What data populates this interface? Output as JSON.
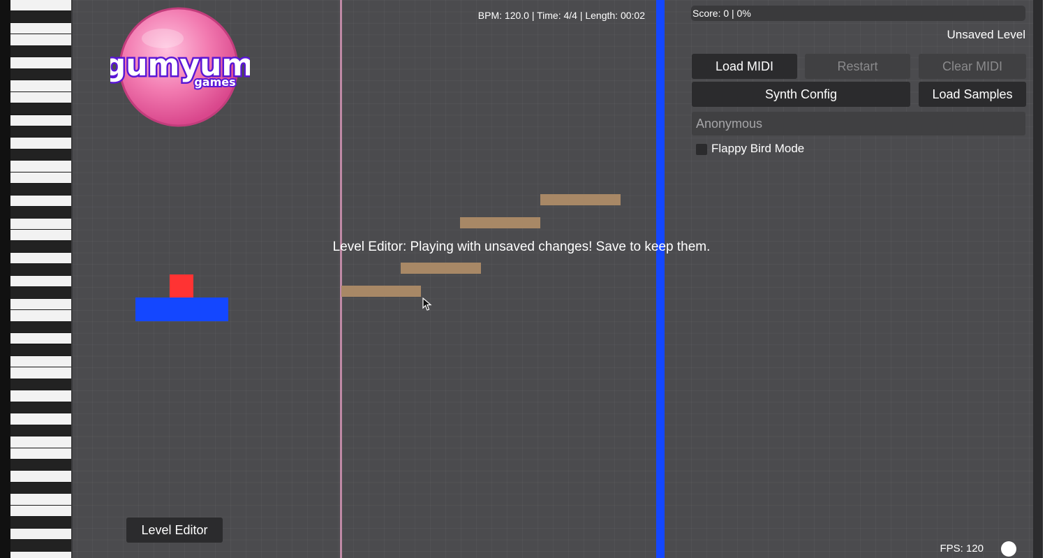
{
  "hud": {
    "song_info": "BPM: 120.0 | Time: 4/4 | Length: 00:02",
    "editor_message": "Level Editor: Playing with unsaved changes! Save to keep them.",
    "score": "Score: 0 | 0%",
    "level_name": "Unsaved Level",
    "fps": "FPS: 120"
  },
  "logo": {
    "word": "gumyum",
    "sub": "games"
  },
  "buttons": {
    "load_midi": "Load MIDI",
    "restart": "Restart",
    "clear_midi": "Clear MIDI",
    "synth_config": "Synth Config",
    "load_samples": "Load Samples",
    "level_editor": "Level Editor"
  },
  "player_name": {
    "value": "Anonymous"
  },
  "options": {
    "flappy_bird_mode": "Flappy Bird Mode",
    "flappy_checked": false
  },
  "colors": {
    "background": "#4b4b4e",
    "note": "#a88866",
    "hit_line": "#1447ff",
    "playhead": "#c08aa6",
    "player": "#ff3333",
    "platform": "#1447ff",
    "logo_ball": "#f27ab0",
    "logo_text_outline": "#5a16d6"
  },
  "icons": {
    "cursor": "mouse-pointer-icon",
    "status": "status-dot-icon"
  }
}
